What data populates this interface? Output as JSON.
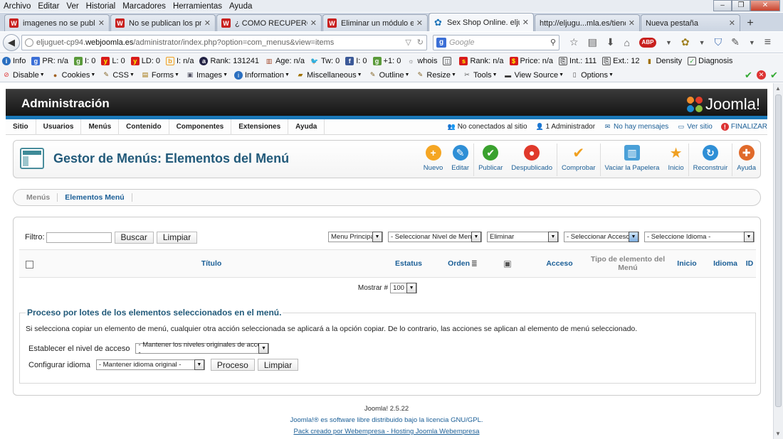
{
  "menubar": [
    "Archivo",
    "Editar",
    "Ver",
    "Historial",
    "Marcadores",
    "Herramientas",
    "Ayuda"
  ],
  "tabs": [
    {
      "label": "imagenes no se public...",
      "icon": "W"
    },
    {
      "label": "No se publican los pre...",
      "icon": "W"
    },
    {
      "label": "¿ COMO RECUPERO U...",
      "icon": "W"
    },
    {
      "label": "Eliminar un módulo e...",
      "icon": "W"
    },
    {
      "label": "Sex Shop Online. eljug...",
      "icon": "J",
      "active": true
    },
    {
      "label": "http://eljugu...mla.es/tienda",
      "icon": "W"
    },
    {
      "label": "Nueva pestaña",
      "icon": ""
    }
  ],
  "url": {
    "prefix": "eljuguet-cp94.",
    "domain": "webjoomla.es",
    "path": "/administrator/index.php?option=com_menus&view=items"
  },
  "search": {
    "placeholder": "Google"
  },
  "seobar": [
    "Info",
    "PR: n/a",
    "I: 0",
    "L: 0",
    "LD: 0",
    "I: n/a",
    "Rank: 131241",
    "Age: n/a",
    "Tw: 0",
    "I: 0",
    "+1: 0",
    "whois",
    "Rank: n/a",
    "Price: n/a",
    "Int.: 111",
    "Ext.: 12",
    "Density",
    "Diagnosis"
  ],
  "webdevbar": [
    "Disable",
    "Cookies",
    "CSS",
    "Forms",
    "Images",
    "Information",
    "Miscellaneous",
    "Outline",
    "Resize",
    "Tools",
    "View Source",
    "Options"
  ],
  "joomla": {
    "admin_title": "Administración",
    "logo_text": "Joomla!",
    "menu": [
      "Sitio",
      "Usuarios",
      "Menús",
      "Contenido",
      "Componentes",
      "Extensiones",
      "Ayuda"
    ],
    "status": {
      "no_conectados": "No conectados al sitio",
      "administrador": "1 Administrador",
      "mensajes": "No hay mensajes",
      "ver_sitio": "Ver sitio",
      "finalizar": "FINALIZAR"
    },
    "page_title": "Gestor de Menús: Elementos del Menú",
    "toolbar": [
      {
        "label": "Nuevo",
        "color": "#f5a623",
        "glyph": "+"
      },
      {
        "label": "Editar",
        "color": "#2f8fd6",
        "glyph": "✎"
      },
      {
        "label": "Publicar",
        "color": "#3aa12e",
        "glyph": "✔"
      },
      {
        "label": "Despublicado",
        "color": "#e0392b",
        "glyph": "●"
      },
      {
        "label": "Comprobar",
        "color": "#f0a020",
        "glyph": "✔"
      },
      {
        "label": "Vaciar la Papelera",
        "color": "#4aa0d8",
        "glyph": "🗑"
      },
      {
        "label": "Inicio",
        "color": "#f0a020",
        "glyph": "★"
      },
      {
        "label": "Reconstruir",
        "color": "#2f8fd6",
        "glyph": "↻"
      },
      {
        "label": "Ayuda",
        "color": "#e06a2b",
        "glyph": "✚"
      }
    ],
    "subtabs": [
      "Menús",
      "Elementos Menú"
    ],
    "filter": {
      "label": "Filtro:",
      "buscar": "Buscar",
      "limpiar": "Limpiar",
      "selects": [
        "Menu Principal",
        "- Seleccionar Nivel de Menú -",
        "Eliminar",
        "- Seleccionar Acceso -",
        "- Seleccione Idioma -"
      ]
    },
    "table": {
      "headers": {
        "titulo": "Título",
        "estatus": "Estatus",
        "orden": "Orden",
        "acceso": "Acceso",
        "tipo": "Tipo de elemento del Menú",
        "inicio": "Inicio",
        "idioma": "Idioma",
        "id": "ID"
      }
    },
    "mostrar": {
      "label": "Mostrar #",
      "value": "100"
    },
    "batch": {
      "legend": "Proceso por lotes de los elementos seleccionados en el menú.",
      "description": "Si selecciona copiar un elemento de menú, cualquier otra acción seleccionada se aplicará a la opción copiar. De lo contrario, las acciones se aplican al elemento de menú seleccionado.",
      "nivel_label": "Establecer el nivel de acceso",
      "nivel_value": "- Mantener los niveles originales de acceso -",
      "idioma_label": "Configurar idioma",
      "idioma_value": "- Mantener idioma original -",
      "proceso": "Proceso",
      "limpiar": "Limpiar"
    },
    "footer": {
      "version": "Joomla! 2.5.22",
      "license": "Joomla!® es software libre distribuido bajo la licencia GNU/GPL.",
      "credit": "Pack creado por Webempresa - Hosting Joomla Webempresa"
    }
  }
}
